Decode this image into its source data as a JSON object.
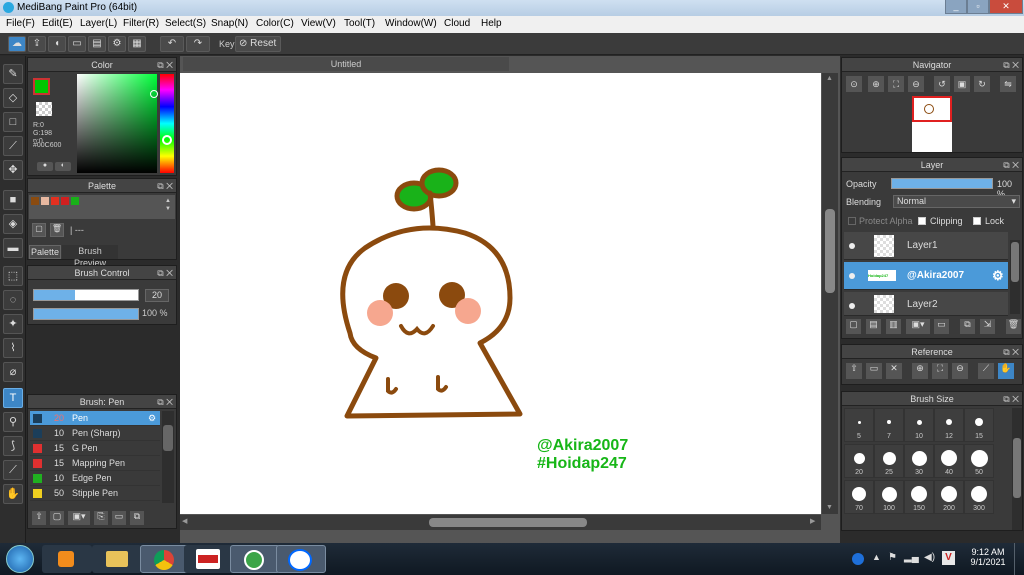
{
  "app": {
    "title": "MediBang Paint Pro (64bit)"
  },
  "menu": [
    "File(F)",
    "Edit(E)",
    "Layer(L)",
    "Filter(R)",
    "Select(S)",
    "Snap(N)",
    "Color(C)",
    "View(V)",
    "Tool(T)",
    "Window(W)",
    "Cloud",
    "Help"
  ],
  "toolbar": {
    "key_label": "Key",
    "reset_label": "Reset"
  },
  "color_panel": {
    "title": "Color",
    "r": "R:0",
    "g": "G:198",
    "b": "B:0",
    "hex": "#00C600",
    "main_color": "#00c600",
    "cut_text": "p:0"
  },
  "palette_panel": {
    "title": "Palette",
    "swatches": [
      "#8a4b10",
      "#e8b8a0",
      "#e23020",
      "#d02020",
      "#18b018"
    ],
    "dash": "---",
    "tabs": [
      "Palette",
      "Brush Preview"
    ]
  },
  "brush_control": {
    "title": "Brush Control",
    "size": "20",
    "opacity": "100 %"
  },
  "brush_list": {
    "title": "Brush: Pen",
    "items": [
      {
        "size": "20",
        "name": "Pen",
        "color": "#1b3e5a",
        "selected": true
      },
      {
        "size": "10",
        "name": "Pen (Sharp)",
        "color": "#1b3e5a"
      },
      {
        "size": "15",
        "name": "G Pen",
        "color": "#e03030"
      },
      {
        "size": "15",
        "name": "Mapping Pen",
        "color": "#e03030"
      },
      {
        "size": "10",
        "name": "Edge Pen",
        "color": "#20b020"
      },
      {
        "size": "50",
        "name": "Stipple Pen",
        "color": "#f0d020"
      }
    ]
  },
  "canvas": {
    "tab_title": "Untitled",
    "watermark_line1": "@Akira2007",
    "watermark_line2": "#Hoidap247",
    "drawing_color": "#8b4a0e",
    "leaf_color": "#19b219",
    "cheek_color": "#f6a78f"
  },
  "navigator": {
    "title": "Navigator"
  },
  "layer_panel": {
    "title": "Layer",
    "opacity_label": "Opacity",
    "opacity_value": "100 %",
    "blending_label": "Blending",
    "blending_value": "Normal",
    "protect_alpha": "Protect Alpha",
    "clipping": "Clipping",
    "lock": "Lock",
    "layers": [
      {
        "name": "Layer1",
        "selected": false,
        "text_thumb": ""
      },
      {
        "name": "@Akira2007",
        "selected": true,
        "text_thumb": "Hoidap247"
      },
      {
        "name": "Layer2",
        "selected": false,
        "text_thumb": ""
      }
    ]
  },
  "reference": {
    "title": "Reference"
  },
  "brush_size": {
    "title": "Brush Size",
    "sizes": [
      "5",
      "7",
      "10",
      "12",
      "15",
      "20",
      "25",
      "30",
      "40",
      "50",
      "70",
      "100",
      "150",
      "200",
      "300"
    ]
  },
  "taskbar": {
    "time": "9:12 AM",
    "date": "9/1/2021"
  }
}
